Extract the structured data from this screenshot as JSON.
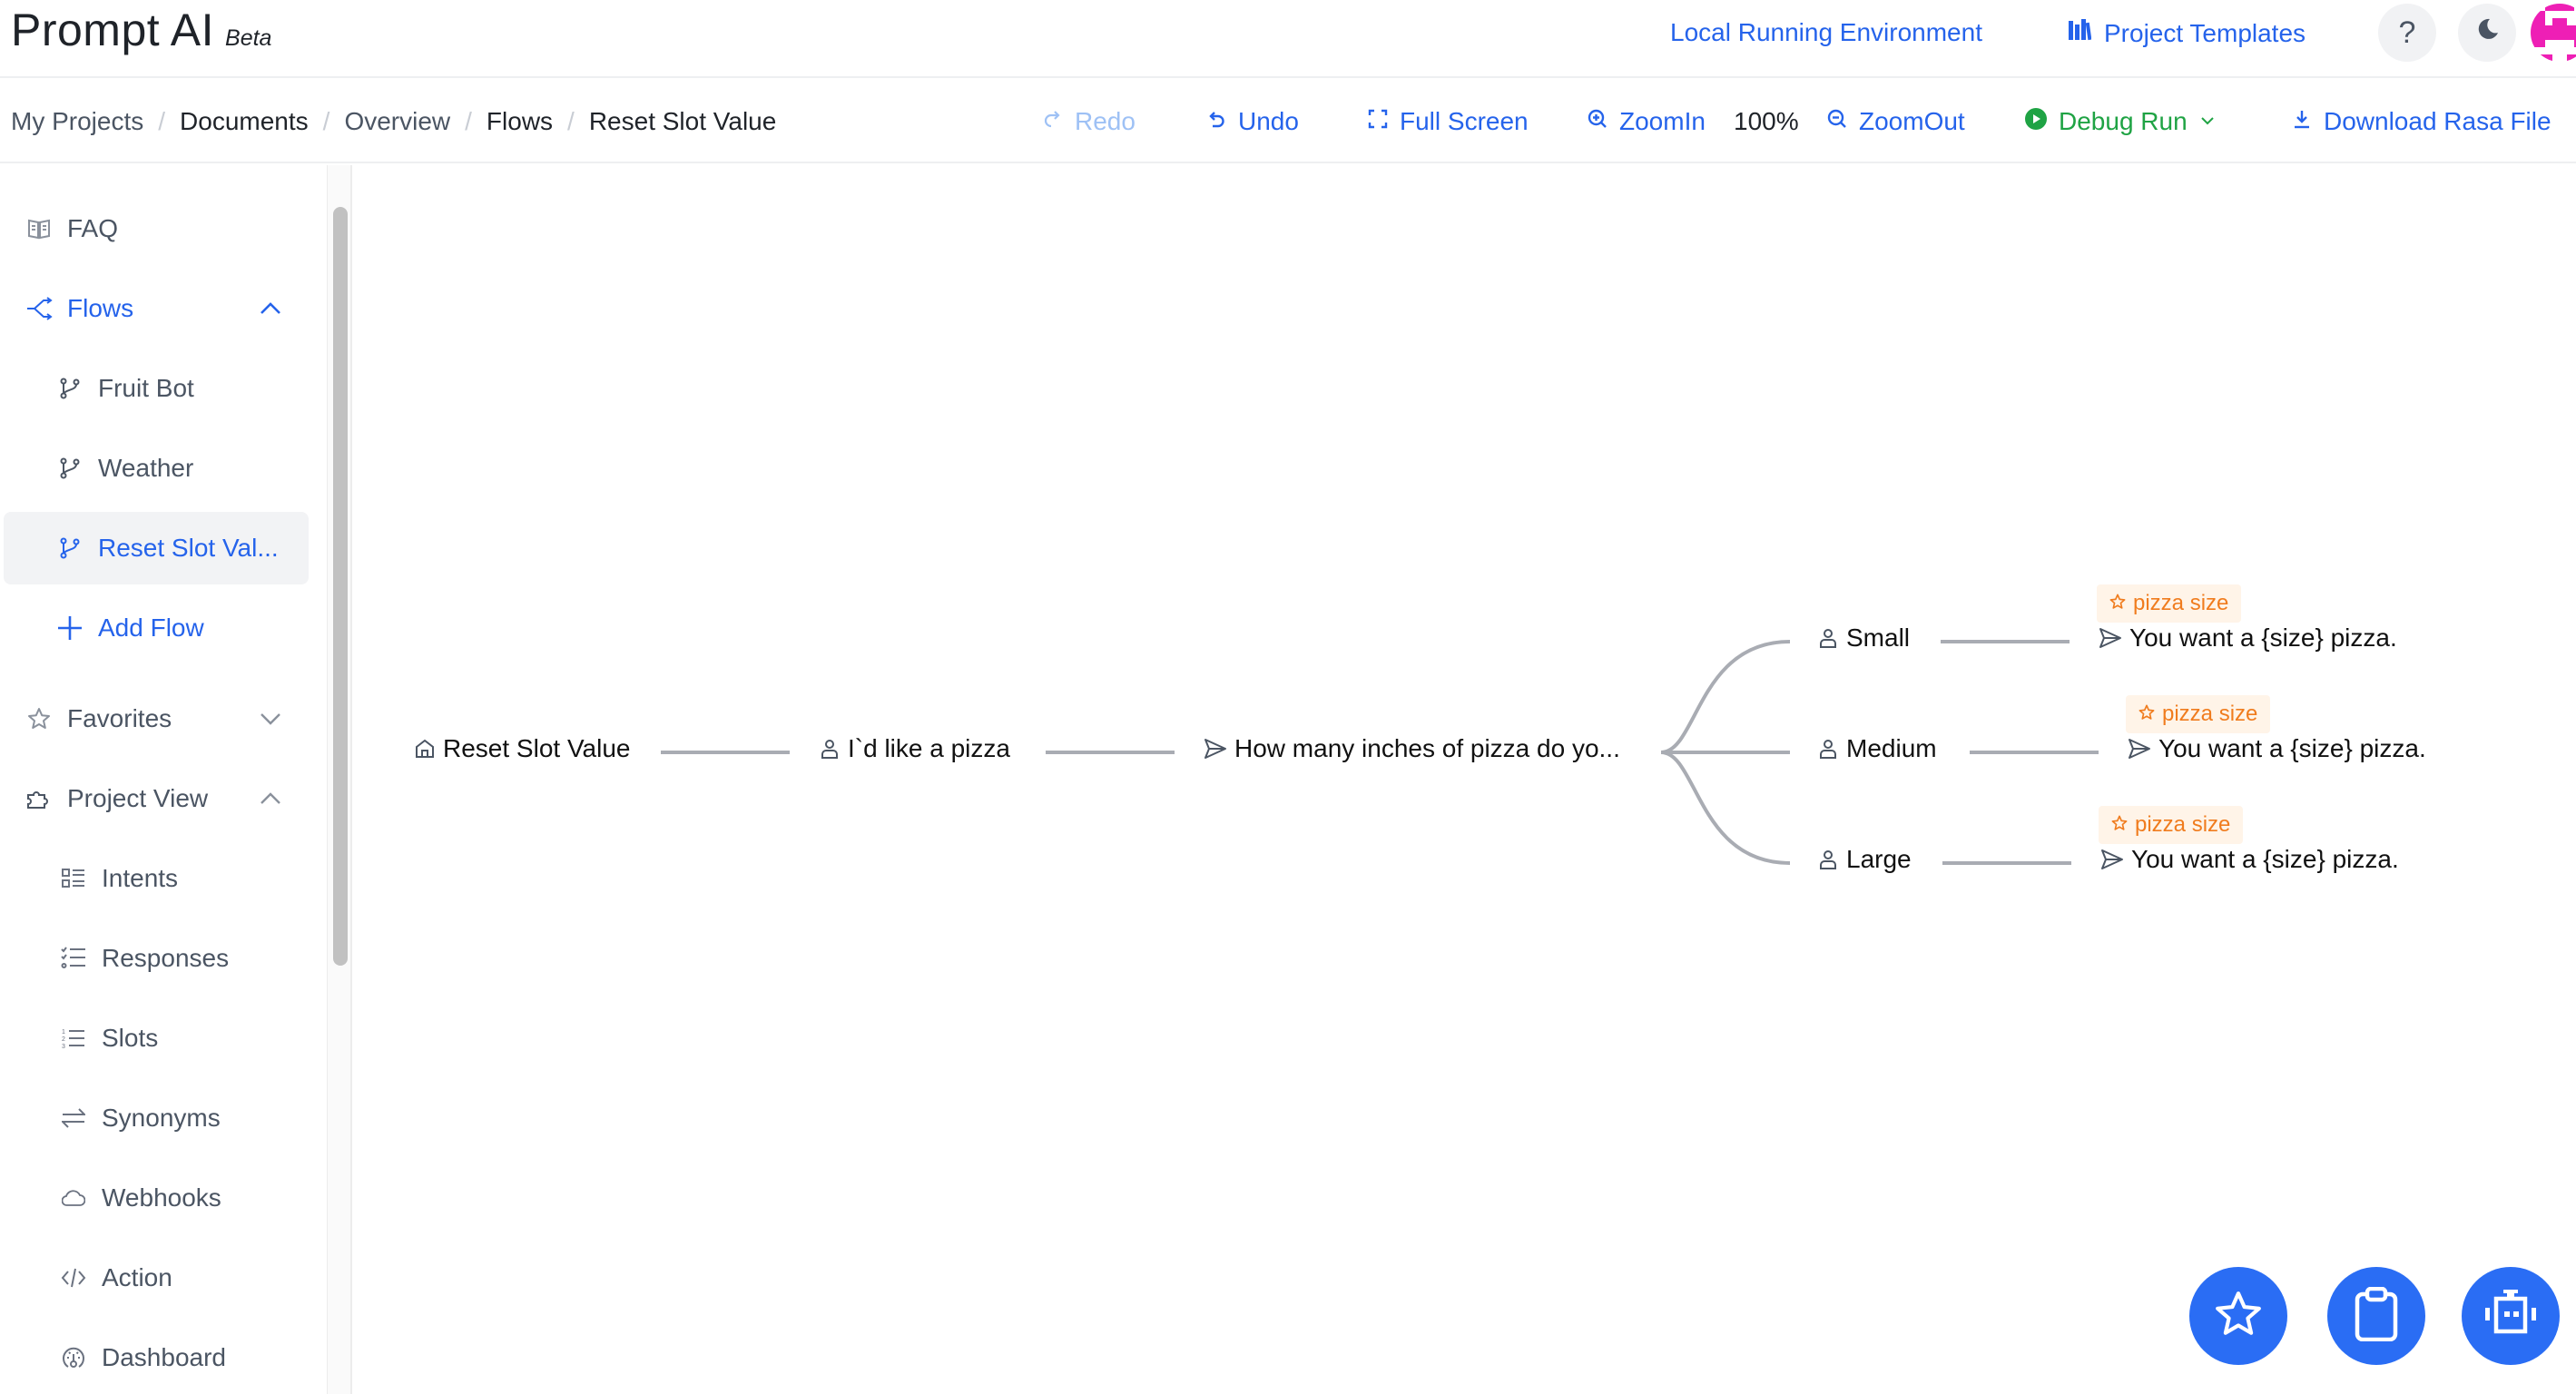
{
  "header": {
    "app_title": "Prompt AI",
    "app_badge": "Beta",
    "local_env_link": "Local Running Environment",
    "templates_link": "Project Templates",
    "help_icon": "question-icon",
    "theme_icon": "moon-icon",
    "avatar_colors": {
      "primary": "#ee1fb5"
    }
  },
  "breadcrumb": [
    "My Projects",
    "Documents",
    "Overview",
    "Flows",
    "Reset Slot Value"
  ],
  "toolbar": {
    "redo": "Redo",
    "undo": "Undo",
    "full_screen": "Full Screen",
    "zoom_in": "ZoomIn",
    "zoom_level": "100%",
    "zoom_out": "ZoomOut",
    "debug_run": "Debug Run",
    "download": "Download Rasa File"
  },
  "sidebar": {
    "faq": "FAQ",
    "flows": "Flows",
    "flow_items": [
      "Fruit Bot",
      "Weather",
      "Reset Slot Val..."
    ],
    "add_flow": "Add Flow",
    "favorites": "Favorites",
    "project_view": "Project View",
    "project_items": [
      "Intents",
      "Responses",
      "Slots",
      "Synonyms",
      "Webhooks",
      "Action",
      "Dashboard"
    ]
  },
  "flow": {
    "start": "Reset Slot Value",
    "user_intent": "I`d like a pizza",
    "bot_question": "How many inches of pizza do yo...",
    "branches": [
      {
        "user": "Small",
        "slot_tag": "pizza size",
        "bot": "You want a {size} pizza."
      },
      {
        "user": "Medium",
        "slot_tag": "pizza size",
        "bot": "You want a {size} pizza."
      },
      {
        "user": "Large",
        "slot_tag": "pizza size",
        "bot": "You want a {size} pizza."
      }
    ]
  },
  "colors": {
    "accent": "#2563eb",
    "debug_green": "#1fa344",
    "tag_orange": "#f07c1e",
    "tag_bg": "#fff4e8",
    "fab_blue": "#2a6df4"
  },
  "fabs": [
    "star-icon",
    "clipboard-icon",
    "robot-icon"
  ]
}
